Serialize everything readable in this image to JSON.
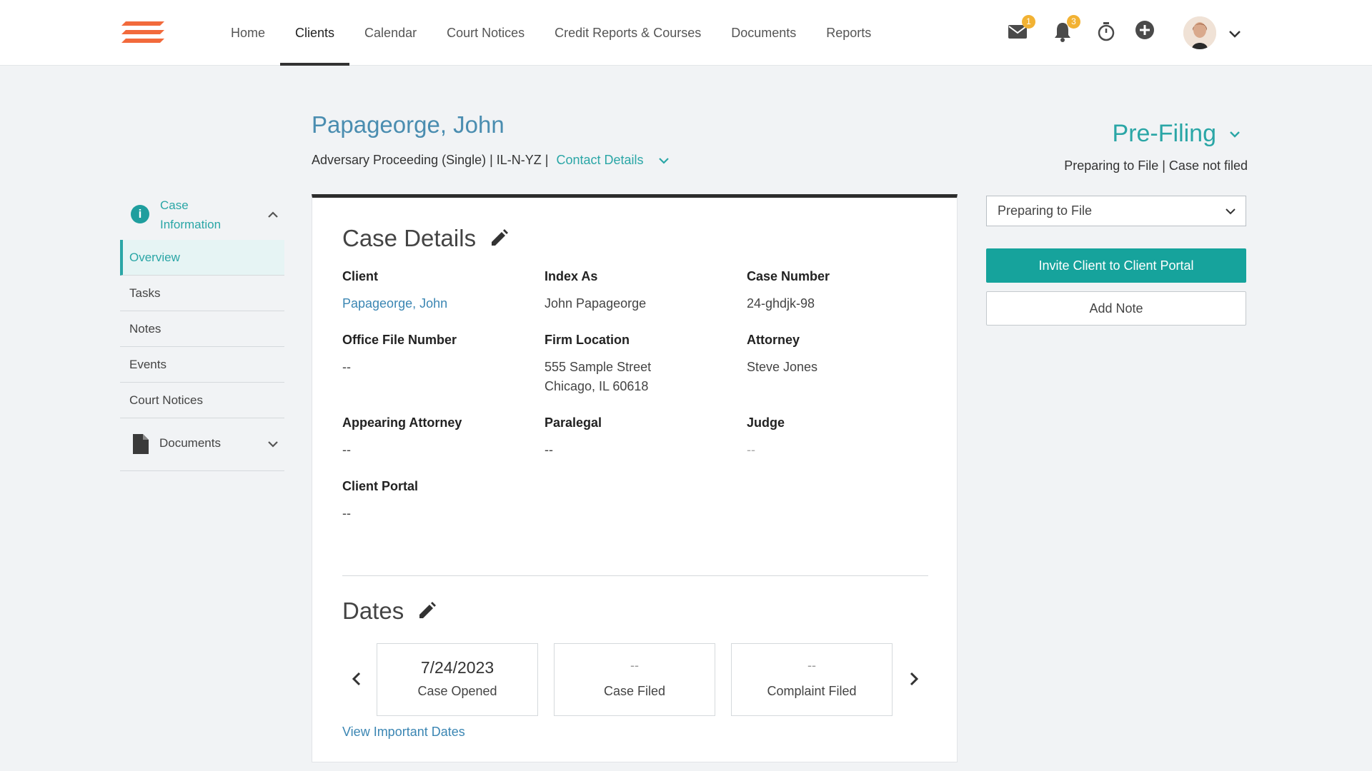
{
  "nav": {
    "items": [
      "Home",
      "Clients",
      "Calendar",
      "Court Notices",
      "Credit Reports & Courses",
      "Documents",
      "Reports"
    ],
    "active": "Clients",
    "mail_badge": "1",
    "notifications_badge": "3"
  },
  "colors": {
    "brand_orange": "#f26a3c",
    "accent_teal": "#16a39c",
    "link_blue": "#3b86b3",
    "badge_yellow": "#f2b233"
  },
  "header": {
    "client_name": "Papageorge, John",
    "case_summary": "Adversary Proceeding (Single) | IL-N-YZ |",
    "contact_details": "Contact Details",
    "status_title": "Pre-Filing",
    "status_sub": "Preparing to File | Case not filed"
  },
  "sidebar": {
    "section_line1": "Case",
    "section_line2": "Information",
    "items": [
      "Overview",
      "Tasks",
      "Notes",
      "Events",
      "Court Notices"
    ],
    "active": "Overview",
    "documents": "Documents"
  },
  "case_details": {
    "title": "Case Details",
    "fields": {
      "client": {
        "label": "Client",
        "value": "Papageorge, John"
      },
      "index_as": {
        "label": "Index As",
        "value": "John Papageorge"
      },
      "case_number": {
        "label": "Case Number",
        "value": "24-ghdjk-98"
      },
      "office_file_number": {
        "label": "Office File Number",
        "value": "--"
      },
      "firm_location": {
        "label": "Firm Location",
        "line1": "555 Sample Street",
        "line2": "Chicago, IL 60618"
      },
      "attorney": {
        "label": "Attorney",
        "value": "Steve Jones"
      },
      "appearing_attorney": {
        "label": "Appearing Attorney",
        "value": "--"
      },
      "paralegal": {
        "label": "Paralegal",
        "value": "--"
      },
      "judge": {
        "label": "Judge",
        "value": "--"
      },
      "client_portal": {
        "label": "Client Portal",
        "value": "--"
      }
    }
  },
  "dates": {
    "title": "Dates",
    "items": [
      {
        "value": "7/24/2023",
        "label": "Case Opened"
      },
      {
        "value": "--",
        "label": "Case Filed"
      },
      {
        "value": "--",
        "label": "Complaint Filed"
      }
    ],
    "view_link": "View Important Dates"
  },
  "right_panel": {
    "status_select": "Preparing to File",
    "invite_button": "Invite Client to Client Portal",
    "add_note_button": "Add Note"
  }
}
